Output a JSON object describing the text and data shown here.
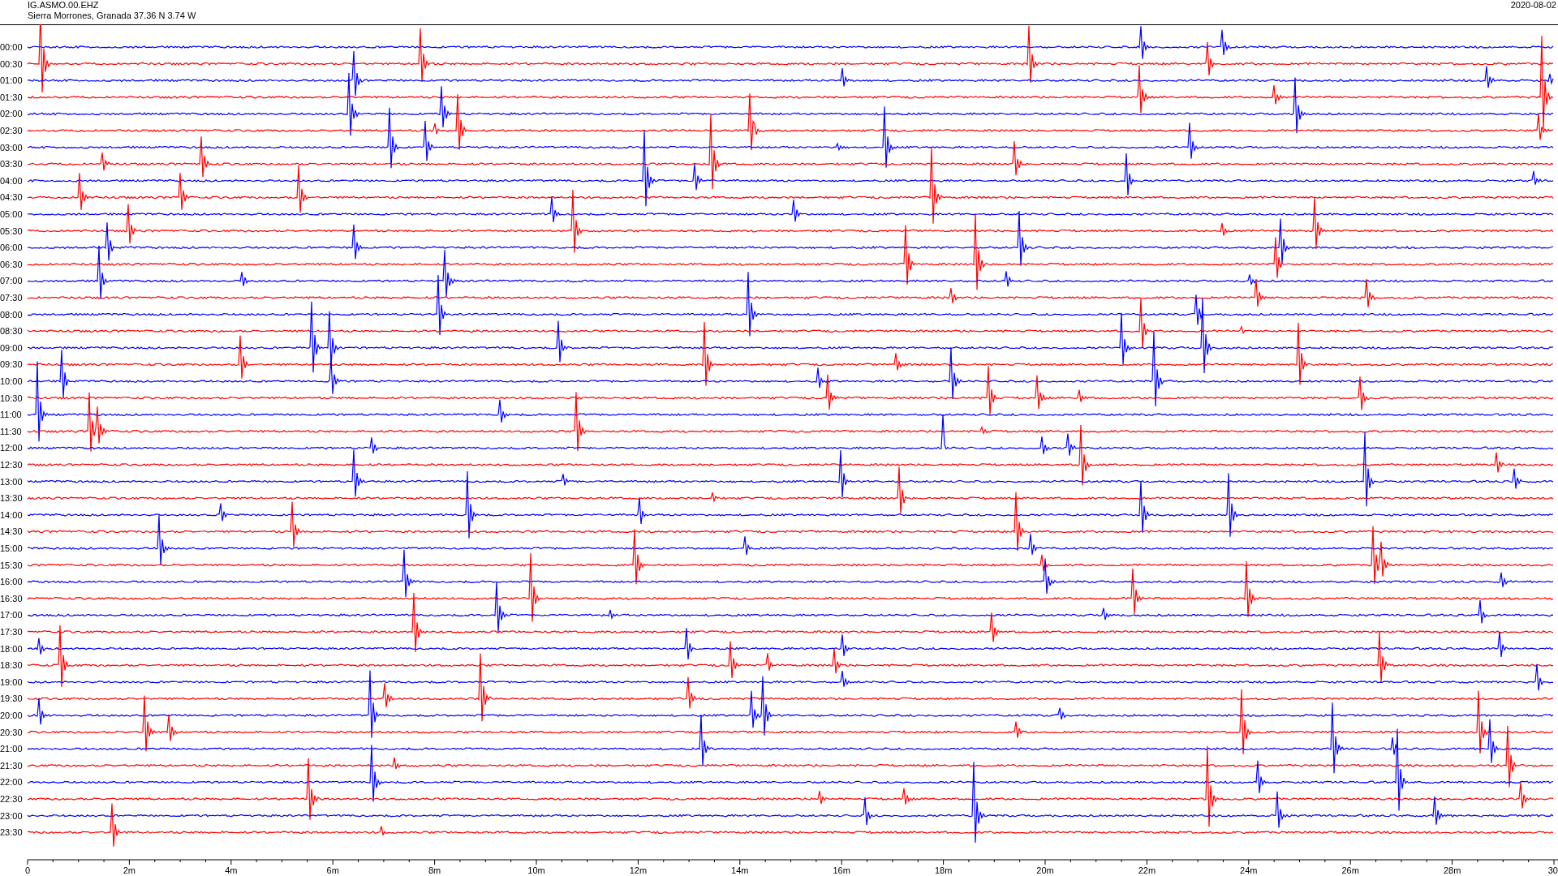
{
  "header": {
    "station": "IG.ASMO.00.EHZ",
    "location": "Sierra Morrones, Granada  37.36 N 3.74 W",
    "date": "2020-08-02"
  },
  "rows": [
    {
      "time": "00:00",
      "color": "#0000ff"
    },
    {
      "time": "00:30",
      "color": "#ff0000"
    },
    {
      "time": "01:00",
      "color": "#0000ff"
    },
    {
      "time": "01:30",
      "color": "#ff0000"
    },
    {
      "time": "02:00",
      "color": "#0000ff"
    },
    {
      "time": "02:30",
      "color": "#ff0000"
    },
    {
      "time": "03:00",
      "color": "#0000ff"
    },
    {
      "time": "03:30",
      "color": "#ff0000"
    },
    {
      "time": "04:00",
      "color": "#0000ff"
    },
    {
      "time": "04:30",
      "color": "#ff0000"
    },
    {
      "time": "05:00",
      "color": "#0000ff"
    },
    {
      "time": "05:30",
      "color": "#ff0000"
    },
    {
      "time": "06:00",
      "color": "#0000ff"
    },
    {
      "time": "06:30",
      "color": "#ff0000"
    },
    {
      "time": "07:00",
      "color": "#0000ff"
    },
    {
      "time": "07:30",
      "color": "#ff0000"
    },
    {
      "time": "08:00",
      "color": "#0000ff"
    },
    {
      "time": "08:30",
      "color": "#ff0000"
    },
    {
      "time": "09:00",
      "color": "#0000ff"
    },
    {
      "time": "09:30",
      "color": "#ff0000"
    },
    {
      "time": "10:00",
      "color": "#0000ff"
    },
    {
      "time": "10:30",
      "color": "#ff0000"
    },
    {
      "time": "11:00",
      "color": "#0000ff"
    },
    {
      "time": "11:30",
      "color": "#ff0000"
    },
    {
      "time": "12:00",
      "color": "#0000ff"
    },
    {
      "time": "12:30",
      "color": "#ff0000"
    },
    {
      "time": "13:00",
      "color": "#0000ff"
    },
    {
      "time": "13:30",
      "color": "#ff0000"
    },
    {
      "time": "14:00",
      "color": "#0000ff"
    },
    {
      "time": "14:30",
      "color": "#ff0000"
    },
    {
      "time": "15:00",
      "color": "#0000ff"
    },
    {
      "time": "15:30",
      "color": "#ff0000"
    },
    {
      "time": "16:00",
      "color": "#0000ff"
    },
    {
      "time": "16:30",
      "color": "#ff0000"
    },
    {
      "time": "17:00",
      "color": "#0000ff"
    },
    {
      "time": "17:30",
      "color": "#ff0000"
    },
    {
      "time": "18:00",
      "color": "#0000ff"
    },
    {
      "time": "18:30",
      "color": "#ff0000"
    },
    {
      "time": "19:00",
      "color": "#0000ff"
    },
    {
      "time": "19:30",
      "color": "#ff0000"
    },
    {
      "time": "20:00",
      "color": "#0000ff"
    },
    {
      "time": "20:30",
      "color": "#ff0000"
    },
    {
      "time": "21:00",
      "color": "#0000ff"
    },
    {
      "time": "21:30",
      "color": "#ff0000"
    },
    {
      "time": "22:00",
      "color": "#0000ff"
    },
    {
      "time": "22:30",
      "color": "#ff0000"
    },
    {
      "time": "23:00",
      "color": "#0000ff"
    },
    {
      "time": "23:30",
      "color": "#ff0000"
    }
  ],
  "x_axis": {
    "ticks": [
      "0",
      "2m",
      "4m",
      "6m",
      "8m",
      "10m",
      "12m",
      "14m",
      "16m",
      "18m",
      "20m",
      "22m",
      "24m",
      "26m",
      "28m",
      "30"
    ]
  }
}
